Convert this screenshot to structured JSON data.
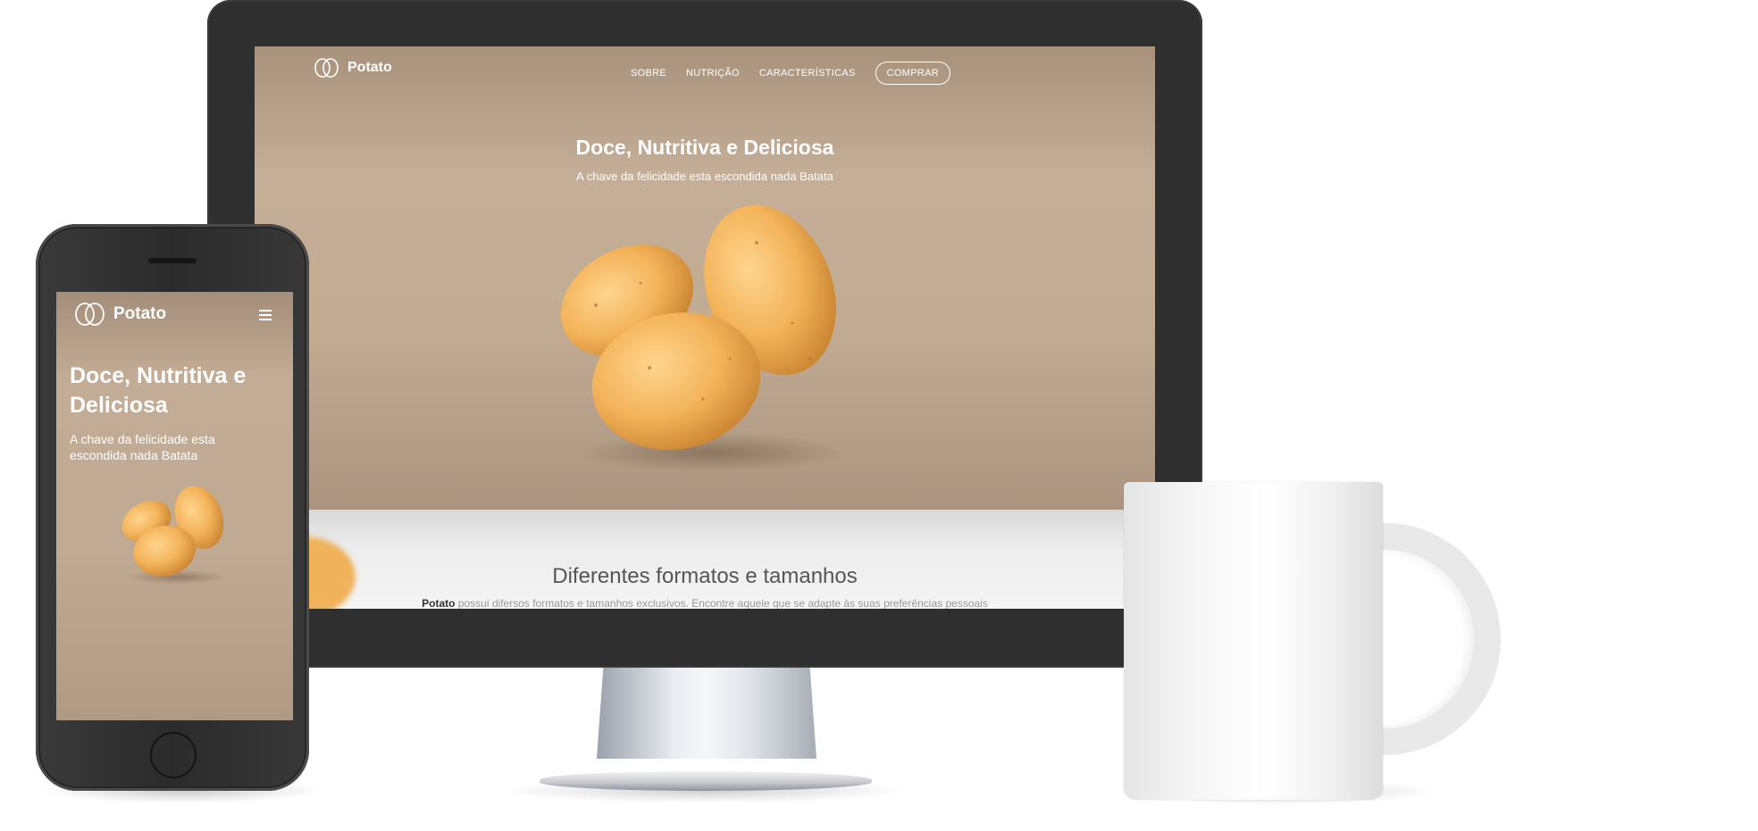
{
  "brand": {
    "name": "Potato"
  },
  "desktop": {
    "nav": {
      "links": [
        "SOBRE",
        "NUTRIÇÃO",
        "CARACTERÍSTICAS"
      ],
      "cta": "COMPRAR"
    },
    "hero": {
      "title": "Doce, Nutritiva e Deliciosa",
      "subtitle": "A chave da felicidade esta escondida nada Batata"
    },
    "section": {
      "title": "Diferentes formatos e tamanhos",
      "text_bold": "Potato",
      "text": "possui difersos formatos e tamanhos exclusivos. Encontre aquele que se adapte às suas preferências pessoais"
    }
  },
  "mobile": {
    "hero": {
      "title": "Doce, Nutritiva e Deliciosa",
      "subtitle": "A chave da felicidade esta escondida nada Batata"
    }
  },
  "colors": {
    "hero_bg": "#c3ad96",
    "potato": "#f2b65c",
    "device_frame": "#2f2f2f"
  }
}
